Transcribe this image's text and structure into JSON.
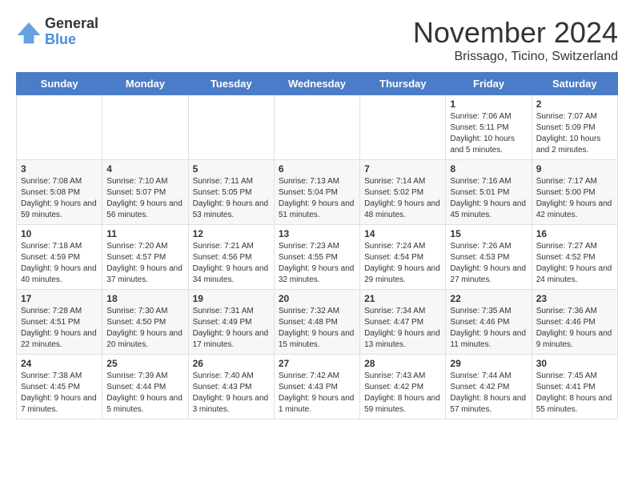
{
  "logo": {
    "general": "General",
    "blue": "Blue"
  },
  "title": "November 2024",
  "location": "Brissago, Ticino, Switzerland",
  "weekdays": [
    "Sunday",
    "Monday",
    "Tuesday",
    "Wednesday",
    "Thursday",
    "Friday",
    "Saturday"
  ],
  "weeks": [
    [
      {
        "day": "",
        "info": ""
      },
      {
        "day": "",
        "info": ""
      },
      {
        "day": "",
        "info": ""
      },
      {
        "day": "",
        "info": ""
      },
      {
        "day": "",
        "info": ""
      },
      {
        "day": "1",
        "info": "Sunrise: 7:06 AM\nSunset: 5:11 PM\nDaylight: 10 hours and 5 minutes."
      },
      {
        "day": "2",
        "info": "Sunrise: 7:07 AM\nSunset: 5:09 PM\nDaylight: 10 hours and 2 minutes."
      }
    ],
    [
      {
        "day": "3",
        "info": "Sunrise: 7:08 AM\nSunset: 5:08 PM\nDaylight: 9 hours and 59 minutes."
      },
      {
        "day": "4",
        "info": "Sunrise: 7:10 AM\nSunset: 5:07 PM\nDaylight: 9 hours and 56 minutes."
      },
      {
        "day": "5",
        "info": "Sunrise: 7:11 AM\nSunset: 5:05 PM\nDaylight: 9 hours and 53 minutes."
      },
      {
        "day": "6",
        "info": "Sunrise: 7:13 AM\nSunset: 5:04 PM\nDaylight: 9 hours and 51 minutes."
      },
      {
        "day": "7",
        "info": "Sunrise: 7:14 AM\nSunset: 5:02 PM\nDaylight: 9 hours and 48 minutes."
      },
      {
        "day": "8",
        "info": "Sunrise: 7:16 AM\nSunset: 5:01 PM\nDaylight: 9 hours and 45 minutes."
      },
      {
        "day": "9",
        "info": "Sunrise: 7:17 AM\nSunset: 5:00 PM\nDaylight: 9 hours and 42 minutes."
      }
    ],
    [
      {
        "day": "10",
        "info": "Sunrise: 7:18 AM\nSunset: 4:59 PM\nDaylight: 9 hours and 40 minutes."
      },
      {
        "day": "11",
        "info": "Sunrise: 7:20 AM\nSunset: 4:57 PM\nDaylight: 9 hours and 37 minutes."
      },
      {
        "day": "12",
        "info": "Sunrise: 7:21 AM\nSunset: 4:56 PM\nDaylight: 9 hours and 34 minutes."
      },
      {
        "day": "13",
        "info": "Sunrise: 7:23 AM\nSunset: 4:55 PM\nDaylight: 9 hours and 32 minutes."
      },
      {
        "day": "14",
        "info": "Sunrise: 7:24 AM\nSunset: 4:54 PM\nDaylight: 9 hours and 29 minutes."
      },
      {
        "day": "15",
        "info": "Sunrise: 7:26 AM\nSunset: 4:53 PM\nDaylight: 9 hours and 27 minutes."
      },
      {
        "day": "16",
        "info": "Sunrise: 7:27 AM\nSunset: 4:52 PM\nDaylight: 9 hours and 24 minutes."
      }
    ],
    [
      {
        "day": "17",
        "info": "Sunrise: 7:28 AM\nSunset: 4:51 PM\nDaylight: 9 hours and 22 minutes."
      },
      {
        "day": "18",
        "info": "Sunrise: 7:30 AM\nSunset: 4:50 PM\nDaylight: 9 hours and 20 minutes."
      },
      {
        "day": "19",
        "info": "Sunrise: 7:31 AM\nSunset: 4:49 PM\nDaylight: 9 hours and 17 minutes."
      },
      {
        "day": "20",
        "info": "Sunrise: 7:32 AM\nSunset: 4:48 PM\nDaylight: 9 hours and 15 minutes."
      },
      {
        "day": "21",
        "info": "Sunrise: 7:34 AM\nSunset: 4:47 PM\nDaylight: 9 hours and 13 minutes."
      },
      {
        "day": "22",
        "info": "Sunrise: 7:35 AM\nSunset: 4:46 PM\nDaylight: 9 hours and 11 minutes."
      },
      {
        "day": "23",
        "info": "Sunrise: 7:36 AM\nSunset: 4:46 PM\nDaylight: 9 hours and 9 minutes."
      }
    ],
    [
      {
        "day": "24",
        "info": "Sunrise: 7:38 AM\nSunset: 4:45 PM\nDaylight: 9 hours and 7 minutes."
      },
      {
        "day": "25",
        "info": "Sunrise: 7:39 AM\nSunset: 4:44 PM\nDaylight: 9 hours and 5 minutes."
      },
      {
        "day": "26",
        "info": "Sunrise: 7:40 AM\nSunset: 4:43 PM\nDaylight: 9 hours and 3 minutes."
      },
      {
        "day": "27",
        "info": "Sunrise: 7:42 AM\nSunset: 4:43 PM\nDaylight: 9 hours and 1 minute."
      },
      {
        "day": "28",
        "info": "Sunrise: 7:43 AM\nSunset: 4:42 PM\nDaylight: 8 hours and 59 minutes."
      },
      {
        "day": "29",
        "info": "Sunrise: 7:44 AM\nSunset: 4:42 PM\nDaylight: 8 hours and 57 minutes."
      },
      {
        "day": "30",
        "info": "Sunrise: 7:45 AM\nSunset: 4:41 PM\nDaylight: 8 hours and 55 minutes."
      }
    ]
  ]
}
